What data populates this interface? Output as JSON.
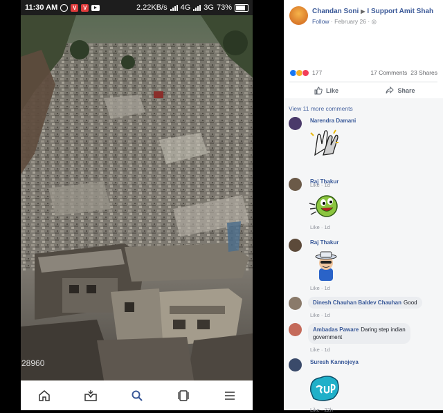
{
  "status_bar": {
    "time": "11:30 AM",
    "speed": "2.22KB/s",
    "network_1": "4G",
    "network_2": "3G",
    "battery": "73%"
  },
  "photo": {
    "watermark": "28960"
  },
  "bottom_nav": [
    "home-icon",
    "inbox-icon",
    "search-icon",
    "pages-icon",
    "menu-icon"
  ],
  "post": {
    "author": "Chandan Soni",
    "page": "I Support Amit Shah",
    "follow": "Follow",
    "date": "February 26",
    "reaction_count": "177",
    "comments_count": "17 Comments",
    "shares_count": "23 Shares",
    "like_label": "Like",
    "share_label": "Share"
  },
  "comments": {
    "more_label": "View 11 more comments",
    "items": [
      {
        "name": "Narendra Damani",
        "text": "",
        "sticker": "clapping-hands-sticker",
        "like": "Like",
        "time": "1d"
      },
      {
        "name": "Raj Thakur",
        "text": "",
        "sticker": "green-laughing-sticker",
        "like": "Like",
        "time": "1d"
      },
      {
        "name": "Raj Thakur",
        "text": "",
        "sticker": "cool-hat-sticker",
        "like": "Like",
        "time": "1d"
      },
      {
        "name": "Dinesh Chauhan Baldev Chauhan",
        "text": "Good",
        "like": "Like",
        "time": "1d"
      },
      {
        "name": "Ambadas Paware",
        "text": "Daring step indian",
        "text2": "government",
        "like": "Like",
        "time": "1d"
      },
      {
        "name": "Suresh Kannojeya",
        "text": "",
        "sticker": "sup-sticker",
        "like": "Like",
        "time": "22h"
      }
    ]
  },
  "colors": {
    "fb_blue": "#3b5998",
    "link_blue": "#385898",
    "bubble": "#ebedf0",
    "panel_bg": "#f5f6f7"
  }
}
